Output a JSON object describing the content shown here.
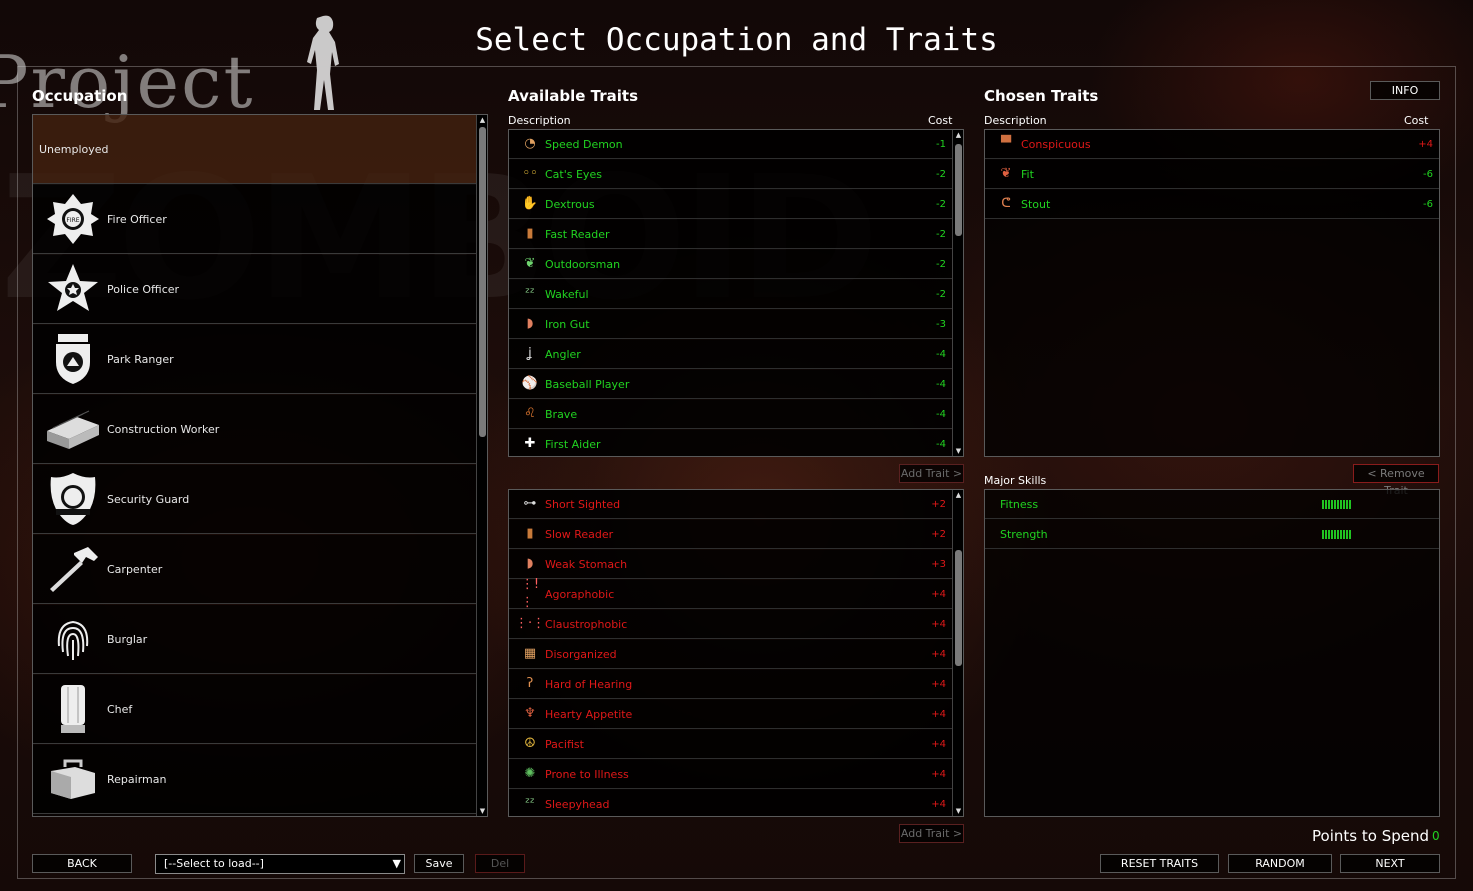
{
  "title": "Select Occupation and Traits",
  "background_logo": {
    "line1": "Project",
    "line2": "ZOMBOID"
  },
  "occupation": {
    "title": "Occupation",
    "items": [
      {
        "label": "Unemployed",
        "icon": "none",
        "selected": true
      },
      {
        "label": "Fire Officer",
        "icon": "fire-dept-badge-icon"
      },
      {
        "label": "Police Officer",
        "icon": "sheriff-star-icon"
      },
      {
        "label": "Park Ranger",
        "icon": "park-ranger-badge-icon"
      },
      {
        "label": "Construction Worker",
        "icon": "bricks-icon"
      },
      {
        "label": "Security Guard",
        "icon": "security-badge-icon"
      },
      {
        "label": "Carpenter",
        "icon": "hammer-icon"
      },
      {
        "label": "Burglar",
        "icon": "fingerprint-icon"
      },
      {
        "label": "Chef",
        "icon": "chef-hat-icon"
      },
      {
        "label": "Repairman",
        "icon": "toolbox-icon"
      }
    ]
  },
  "available_traits": {
    "title": "Available Traits",
    "col_description": "Description",
    "col_cost": "Cost",
    "positive": [
      {
        "name": "Speed Demon",
        "cost": "-1",
        "icon": "speedometer-icon"
      },
      {
        "name": "Cat's Eyes",
        "cost": "-2",
        "icon": "cat-eyes-icon"
      },
      {
        "name": "Dextrous",
        "cost": "-2",
        "icon": "hand-icon"
      },
      {
        "name": "Fast Reader",
        "cost": "-2",
        "icon": "book-icon"
      },
      {
        "name": "Outdoorsman",
        "cost": "-2",
        "icon": "leaf-icon"
      },
      {
        "name": "Wakeful",
        "cost": "-2",
        "icon": "zzz-icon"
      },
      {
        "name": "Iron Gut",
        "cost": "-3",
        "icon": "stomach-icon"
      },
      {
        "name": "Angler",
        "cost": "-4",
        "icon": "fishhook-icon"
      },
      {
        "name": "Baseball Player",
        "cost": "-4",
        "icon": "baseball-icon"
      },
      {
        "name": "Brave",
        "cost": "-4",
        "icon": "lion-icon"
      },
      {
        "name": "First Aider",
        "cost": "-4",
        "icon": "first-aid-icon"
      }
    ],
    "negative": [
      {
        "name": "Short Sighted",
        "cost": "+2",
        "icon": "glasses-icon"
      },
      {
        "name": "Slow Reader",
        "cost": "+2",
        "icon": "book-icon"
      },
      {
        "name": "Weak Stomach",
        "cost": "+3",
        "icon": "stomach-icon"
      },
      {
        "name": "Agoraphobic",
        "cost": "+4",
        "icon": "agoraphobic-icon"
      },
      {
        "name": "Claustrophobic",
        "cost": "+4",
        "icon": "claustrophobic-icon"
      },
      {
        "name": "Disorganized",
        "cost": "+4",
        "icon": "messy-box-icon"
      },
      {
        "name": "Hard of Hearing",
        "cost": "+4",
        "icon": "ear-icon"
      },
      {
        "name": "Hearty Appetite",
        "cost": "+4",
        "icon": "apple-core-icon"
      },
      {
        "name": "Pacifist",
        "cost": "+4",
        "icon": "peace-icon"
      },
      {
        "name": "Prone to Illness",
        "cost": "+4",
        "icon": "germ-icon"
      },
      {
        "name": "Sleepyhead",
        "cost": "+4",
        "icon": "zzz-icon"
      }
    ],
    "add_trait_label": "Add Trait >"
  },
  "chosen_traits": {
    "title": "Chosen Traits",
    "info_label": "INFO",
    "col_description": "Description",
    "col_cost": "Cost",
    "items": [
      {
        "name": "Conspicuous",
        "cost": "+4",
        "type": "neg",
        "icon": "top-hat-icon"
      },
      {
        "name": "Fit",
        "cost": "-6",
        "type": "pos",
        "icon": "lungs-icon"
      },
      {
        "name": "Stout",
        "cost": "-6",
        "type": "pos",
        "icon": "flexed-arm-icon"
      }
    ],
    "remove_trait_label": "< Remove Trait"
  },
  "major_skills": {
    "title": "Major Skills",
    "items": [
      {
        "name": "Fitness",
        "level": 10
      },
      {
        "name": "Strength",
        "level": 10
      }
    ]
  },
  "points": {
    "label": "Points to Spend",
    "value": "0"
  },
  "footer": {
    "back_label": "BACK",
    "load_select_value": "[--Select to load--]",
    "save_label": "Save",
    "del_label": "Del",
    "reset_label": "RESET TRAITS",
    "random_label": "RANDOM",
    "next_label": "NEXT"
  },
  "colors": {
    "positive": "#21d321",
    "negative": "#e01818",
    "selected_row": "#5a2d14"
  }
}
